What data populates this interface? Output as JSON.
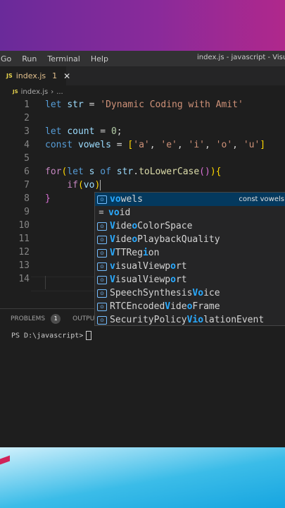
{
  "menubar": {
    "items": [
      "Go",
      "Run",
      "Terminal",
      "Help"
    ],
    "window_title": "index.js - javascript - Visual St"
  },
  "tab": {
    "icon_label": "JS",
    "name": "index.js",
    "modified_count": "1",
    "close_symbol": "✕"
  },
  "breadcrumb": {
    "icon_label": "JS",
    "file": "index.js",
    "separator": "›",
    "ellipsis": "..."
  },
  "editor": {
    "line_numbers": [
      "1",
      "2",
      "3",
      "4",
      "5",
      "6",
      "7",
      "8",
      "9",
      "10",
      "11",
      "12",
      "13",
      "14"
    ],
    "lines": [
      "let str = 'Dynamic Coding with Amit'",
      "",
      "let count = 0;",
      "const vowels = ['a', 'e', 'i', 'o', 'u']",
      "",
      "for(let s of str.toLowerCase()){",
      "    if(vo)",
      "}"
    ]
  },
  "suggestions": {
    "items": [
      {
        "pre": "",
        "hl": "vo",
        "post": "wels",
        "kind": "var",
        "icon": "[⊙]",
        "detail": "const vowels"
      },
      {
        "pre": "",
        "hl": "vo",
        "post": "id",
        "kind": "keyword",
        "icon": "≡",
        "detail": ""
      },
      {
        "pre": "",
        "hl": "V",
        "post": "ide",
        "hl2": "o",
        "post2": "ColorSpace",
        "kind": "var",
        "icon": "[⊙]",
        "detail": ""
      },
      {
        "pre": "",
        "hl": "V",
        "post": "ide",
        "hl2": "o",
        "post2": "PlaybackQuality",
        "kind": "var",
        "icon": "[⊙]",
        "detail": ""
      },
      {
        "pre": "",
        "hl": "V",
        "post": "TTReg",
        "hl2": "i",
        "post2": "on",
        "kind": "var",
        "icon": "[⊙]",
        "detail": ""
      },
      {
        "pre": "",
        "hl": "v",
        "post": "isualViewp",
        "hl2": "o",
        "post2": "rt",
        "kind": "var",
        "icon": "[⊙]",
        "detail": ""
      },
      {
        "pre": "",
        "hl": "V",
        "post": "isualViewp",
        "hl2": "o",
        "post2": "rt",
        "kind": "var",
        "icon": "[⊙]",
        "detail": ""
      },
      {
        "pre": "SpeechSynthesis",
        "hl": "Vo",
        "post": "ice",
        "kind": "var",
        "icon": "[⊙]",
        "detail": ""
      },
      {
        "pre": "RTCEncoded",
        "hl": "V",
        "post": "ide",
        "hl2": "o",
        "post2": "Frame",
        "kind": "var",
        "icon": "[⊙]",
        "detail": ""
      },
      {
        "pre": "SecurityPolicy",
        "hl": "Vio",
        "post": "lationEvent",
        "kind": "var",
        "icon": "[⊙]",
        "detail": ""
      }
    ]
  },
  "panel": {
    "problems_label": "PROBLEMS",
    "problems_count": "1",
    "output_label": "OUTPUT"
  },
  "terminal": {
    "prompt": "PS D:\\javascript>"
  },
  "colors": {
    "editor_bg": "#1e1e1e",
    "keyword": "#569cd6",
    "string": "#ce9178",
    "selected_suggestion": "#04395e",
    "match_highlight": "#2aaaff"
  }
}
